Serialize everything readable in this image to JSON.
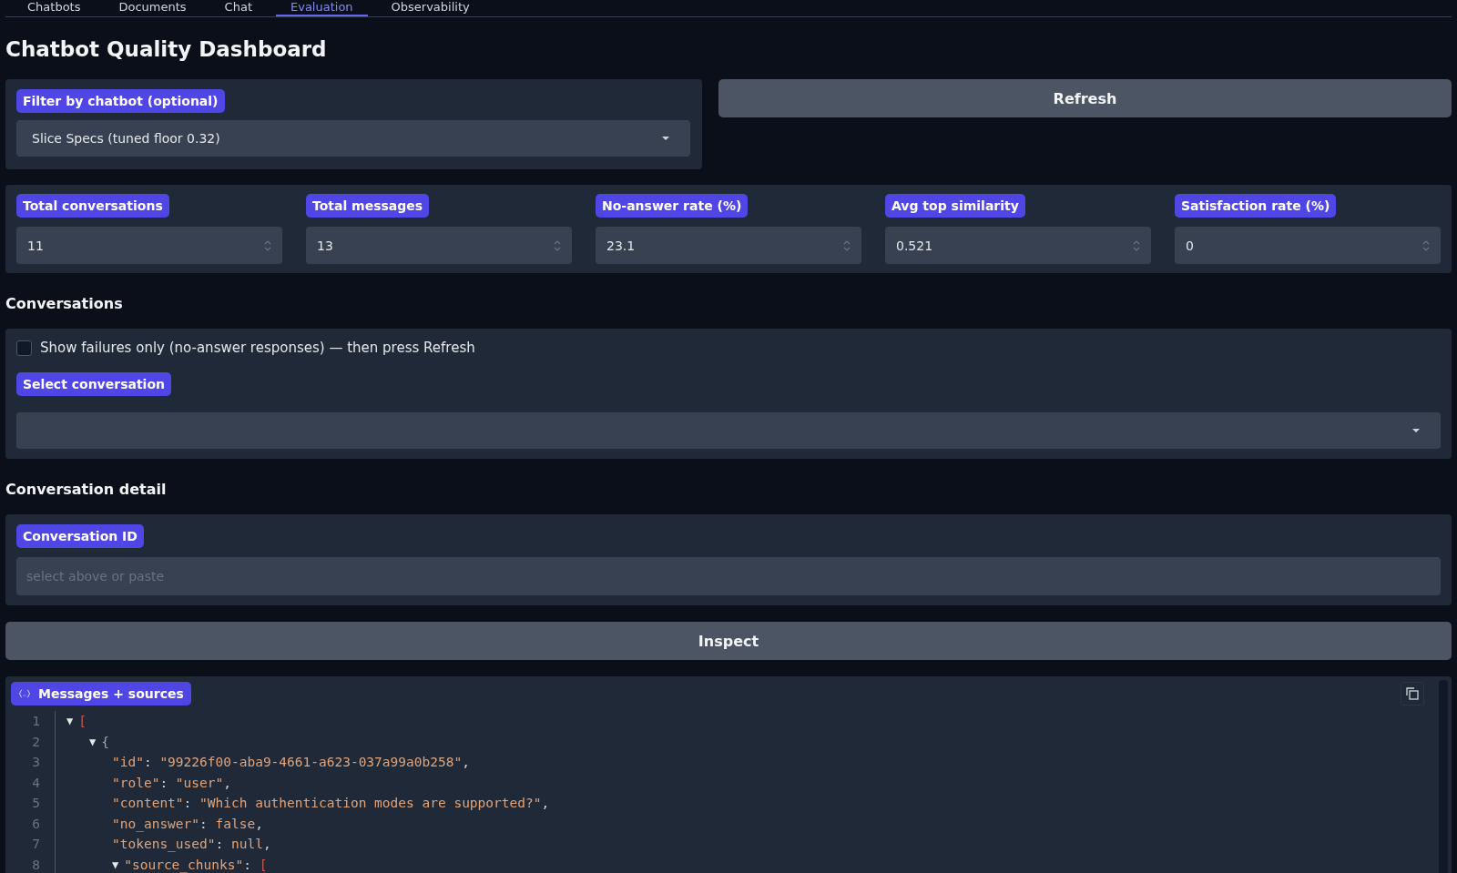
{
  "tabs": [
    {
      "label": "Chatbots",
      "selected": false
    },
    {
      "label": "Documents",
      "selected": false
    },
    {
      "label": "Chat",
      "selected": false
    },
    {
      "label": "Evaluation",
      "selected": true
    },
    {
      "label": "Observability",
      "selected": false
    }
  ],
  "title": "Chatbot Quality Dashboard",
  "filter": {
    "label": "Filter by chatbot (optional)",
    "value": "Slice Specs (tuned floor 0.32)"
  },
  "refresh_button": "Refresh",
  "metrics": [
    {
      "label": "Total conversations",
      "value": "11"
    },
    {
      "label": "Total messages",
      "value": "13"
    },
    {
      "label": "No-answer rate (%)",
      "value": "23.1"
    },
    {
      "label": "Avg top similarity",
      "value": "0.521"
    },
    {
      "label": "Satisfaction rate (%)",
      "value": "0"
    }
  ],
  "conversations": {
    "heading": "Conversations",
    "failures_only": {
      "label": "Show failures only (no-answer responses) — then press Refresh",
      "checked": false
    },
    "select_label": "Select conversation"
  },
  "detail": {
    "heading": "Conversation detail",
    "id_label": "Conversation ID",
    "id_placeholder": "select above or paste"
  },
  "inspect_button": "Inspect",
  "json_view": {
    "label": "Messages + sources",
    "lines": [
      {
        "number": "1",
        "toggle": "▼",
        "parts": [
          {
            "kind": "bracket",
            "text": "["
          }
        ],
        "children": [
          {
            "number": "2",
            "toggle": "▼",
            "parts": [
              {
                "kind": "brace",
                "text": "{"
              }
            ],
            "children": [
              {
                "number": "3",
                "parts": [
                  {
                    "kind": "key",
                    "text": "\"id\""
                  },
                  {
                    "kind": "punct",
                    "text": ": "
                  },
                  {
                    "kind": "string",
                    "text": "\"99226f00-aba9-4661-a623-037a99a0b258\""
                  },
                  {
                    "kind": "punct",
                    "text": ","
                  }
                ]
              },
              {
                "number": "4",
                "parts": [
                  {
                    "kind": "key",
                    "text": "\"role\""
                  },
                  {
                    "kind": "punct",
                    "text": ": "
                  },
                  {
                    "kind": "string",
                    "text": "\"user\""
                  },
                  {
                    "kind": "punct",
                    "text": ","
                  }
                ]
              },
              {
                "number": "5",
                "parts": [
                  {
                    "kind": "key",
                    "text": "\"content\""
                  },
                  {
                    "kind": "punct",
                    "text": ": "
                  },
                  {
                    "kind": "string",
                    "text": "\"Which authentication modes are supported?\""
                  },
                  {
                    "kind": "punct",
                    "text": ","
                  }
                ]
              },
              {
                "number": "6",
                "parts": [
                  {
                    "kind": "key",
                    "text": "\"no_answer\""
                  },
                  {
                    "kind": "punct",
                    "text": ": "
                  },
                  {
                    "kind": "literal",
                    "text": "false"
                  },
                  {
                    "kind": "punct",
                    "text": ","
                  }
                ]
              },
              {
                "number": "7",
                "parts": [
                  {
                    "kind": "key",
                    "text": "\"tokens_used\""
                  },
                  {
                    "kind": "punct",
                    "text": ": "
                  },
                  {
                    "kind": "literal",
                    "text": "null"
                  },
                  {
                    "kind": "punct",
                    "text": ","
                  }
                ]
              },
              {
                "number": "8",
                "toggle": "▼",
                "parts": [
                  {
                    "kind": "key",
                    "text": "\"source_chunks\""
                  },
                  {
                    "kind": "punct",
                    "text": ": "
                  },
                  {
                    "kind": "bracket",
                    "text": "["
                  }
                ]
              }
            ]
          }
        ]
      }
    ]
  }
}
